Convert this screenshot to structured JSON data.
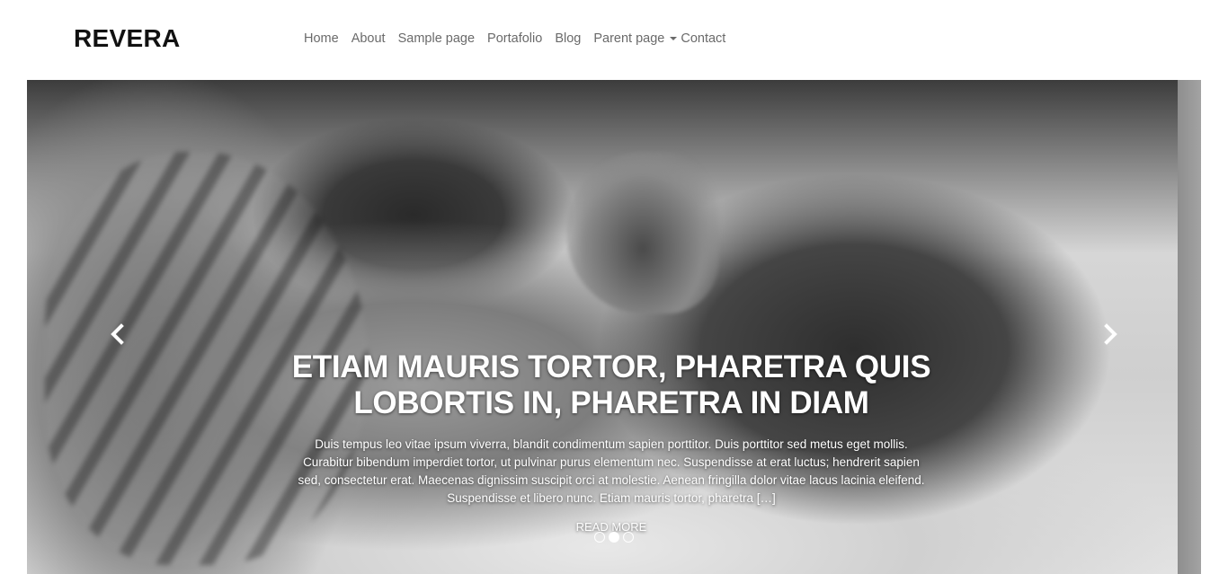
{
  "site": {
    "logo": "REVERA"
  },
  "nav": {
    "items": [
      {
        "label": "Home"
      },
      {
        "label": "About"
      },
      {
        "label": "Sample page"
      },
      {
        "label": "Portafolio"
      },
      {
        "label": "Blog"
      },
      {
        "label": "Parent page",
        "has_dropdown": true
      },
      {
        "label": "Contact"
      }
    ]
  },
  "slider": {
    "slide": {
      "title": "ETIAM MAURIS TORTOR, PHARETRA QUIS LOBORTIS IN, PHARETRA IN DIAM",
      "excerpt": "Duis tempus leo vitae ipsum viverra, blandit condimentum sapien porttitor. Duis porttitor sed metus eget mollis. Curabitur bibendum imperdiet tortor, ut pulvinar purus elementum nec. Suspendisse at erat luctus; hendrerit sapien sed, consectetur erat. Maecenas dignissim suscipit orci at molestie. Aenean fringilla dolor vitae lacus lacinia eleifend. Suspendisse et libero nunc. Etiam mauris tortor, pharetra […]",
      "read_more": "READ MORE",
      "image_desc": "grayscale photo of kitten and puppy sleeping"
    },
    "dots_total": 3,
    "active_dot": 2,
    "prev_icon": "chevron-left-icon",
    "next_icon": "chevron-right-icon"
  }
}
